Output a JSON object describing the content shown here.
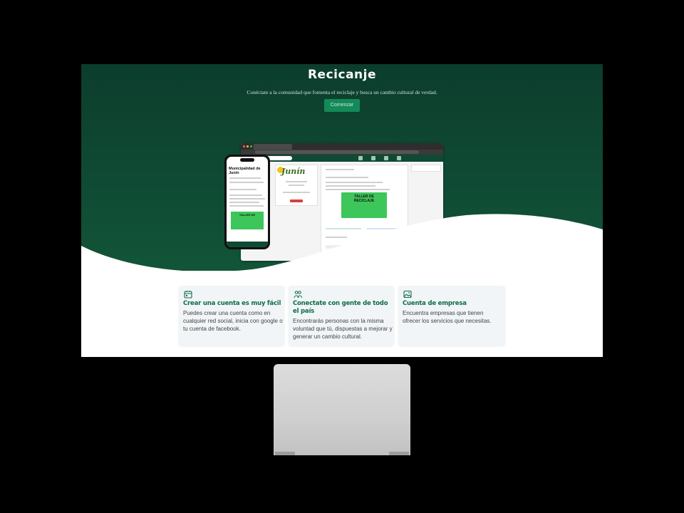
{
  "hero": {
    "title": "Recicanje",
    "subtitle": "Conéctate a la comunidad que fomenta el reciclaje y busca un cambio cultural de verdad.",
    "cta_label": "Comenzar"
  },
  "colors": {
    "hero_dark": "#0c3d2c",
    "hero_mid": "#125538",
    "accent": "#138a58",
    "card_title": "#0d6b45",
    "card_bg": "#f1f5f7"
  },
  "mockups": {
    "phone_title": "Municipalidad de Junín",
    "poster_text_1": "TALLER DE",
    "poster_text_2": "RECICLAJE",
    "logo_text": "Junín"
  },
  "features": [
    {
      "icon": "calendar-icon",
      "title": "Crear una cuenta es muy fácil",
      "description": "Puedes crear una cuenta como en cualquier red social, inicia con google o tu cuenta de facebook."
    },
    {
      "icon": "people-icon",
      "title": "Conectate con gente de todo el país",
      "description": "Encontrarás personas con la misma voluntad que tú, dispuestas a mejorar y generar un cambio cultural."
    },
    {
      "icon": "image-icon",
      "title": "Cuenta de empresa",
      "description": "Encuentra empresas que tienen ofrecer los servicios que necesitas."
    }
  ]
}
